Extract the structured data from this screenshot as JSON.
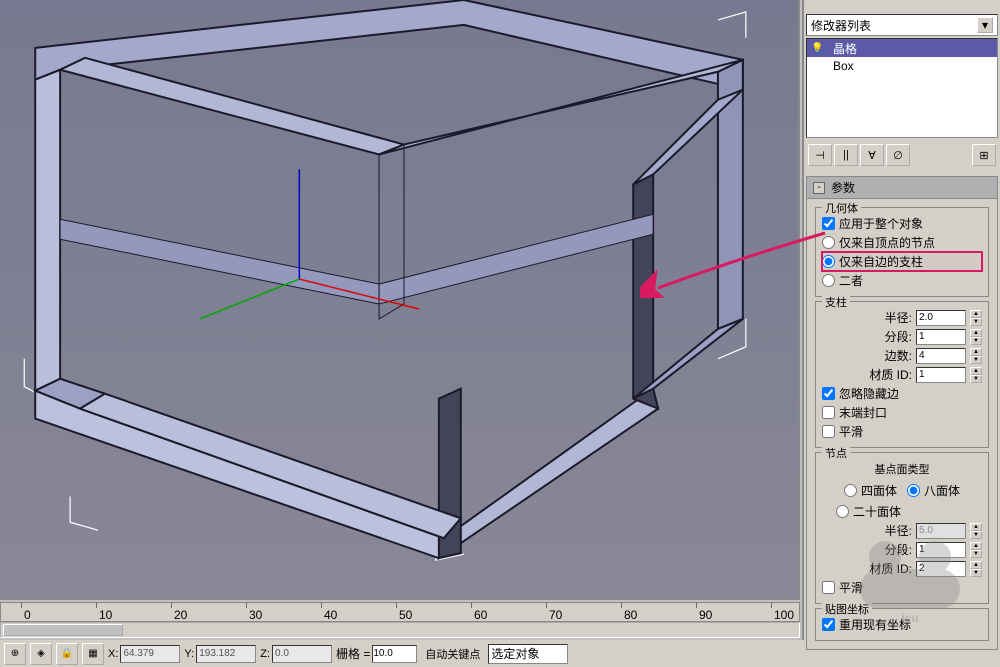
{
  "viewport": {
    "gizmo": {
      "x": "X",
      "y": "Y",
      "z": "Z"
    }
  },
  "ruler": {
    "ticks": [
      "0",
      "10",
      "20",
      "30",
      "40",
      "50",
      "60",
      "70",
      "80",
      "90",
      "100"
    ]
  },
  "statusbar": {
    "x_label": "X:",
    "x_value": "64.379",
    "y_label": "Y:",
    "y_value": "193.182",
    "z_label": "Z:",
    "z_value": "0.0",
    "grid_label": "栅格 =",
    "grid_value": "10.0",
    "autokey_label": "自动关键点",
    "selection_label": "选定对象"
  },
  "modifier_dropdown": {
    "label": "修改器列表"
  },
  "stack": {
    "item1": "晶格",
    "item2": "Box"
  },
  "stack_btn": {
    "pin": "⊣",
    "show": "||",
    "make": "∀",
    "remove": "∅",
    "config": "⊞"
  },
  "rollout": {
    "title": "参数",
    "geometry": {
      "legend": "几何体",
      "apply": "应用于整个对象",
      "radio1": "仅来自顶点的节点",
      "radio2": "仅来自边的支柱",
      "radio3": "二者"
    },
    "struts": {
      "legend": "支柱",
      "radius_label": "半径:",
      "radius_value": "2.0",
      "segments_label": "分段:",
      "segments_value": "1",
      "sides_label": "边数:",
      "sides_value": "4",
      "matid_label": "材质 ID:",
      "matid_value": "1",
      "ignore_hidden": "忽略隐藏边",
      "end_caps": "末端封口",
      "smooth": "平滑"
    },
    "joints": {
      "legend": "节点",
      "basetype_label": "基点面类型",
      "tetra": "四面体",
      "octa": "八面体",
      "icosa": "二十面体",
      "radius_label": "半径:",
      "radius_value": "5.0",
      "segments_label": "分段:",
      "segments_value": "1",
      "matid_label": "材质 ID:",
      "matid_value": "2",
      "smooth": "平滑"
    },
    "mapping": {
      "legend": "贴图坐标",
      "reuse": "重用现有坐标"
    }
  },
  "watermark_text": "icu"
}
